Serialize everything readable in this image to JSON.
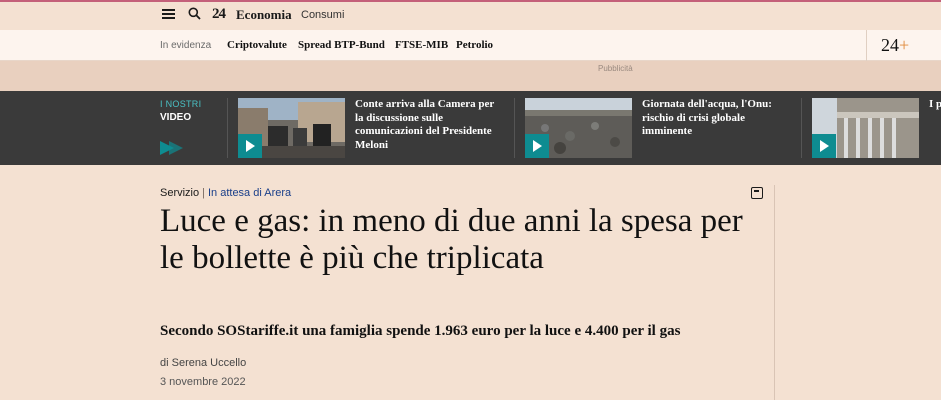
{
  "nav": {
    "logo": "24",
    "section": "Economia",
    "subsection": "Consumi"
  },
  "highlights": {
    "label": "In evidenza",
    "items": [
      "Criptovalute",
      "Spread BTP-Bund",
      "FTSE-MIB",
      "Petrolio"
    ],
    "brand": "24",
    "brand_plus": "+"
  },
  "ad": {
    "label": "Pubblicità"
  },
  "videos": {
    "kicker": "I NOSTRI",
    "title": "VIDEO",
    "items": [
      {
        "text": "Conte arriva alla Camera per la discussione sulle comunicazioni del Presidente Meloni"
      },
      {
        "text": "Giornata dell'acqua, l'Onu: rischio di crisi globale imminente"
      },
      {
        "text": "I p"
      }
    ]
  },
  "article": {
    "kicker_type": "Servizio",
    "kicker_tag": "In attesa di Arera",
    "headline": "Luce e gas: in meno di due anni la spesa per le bollette è più che triplicata",
    "subhead": "Secondo SOStariffe.it una famiglia spende 1.963 euro per la luce e 4.400 per il gas",
    "byline": "di Serena Uccello",
    "date": "3 novembre 2022"
  }
}
